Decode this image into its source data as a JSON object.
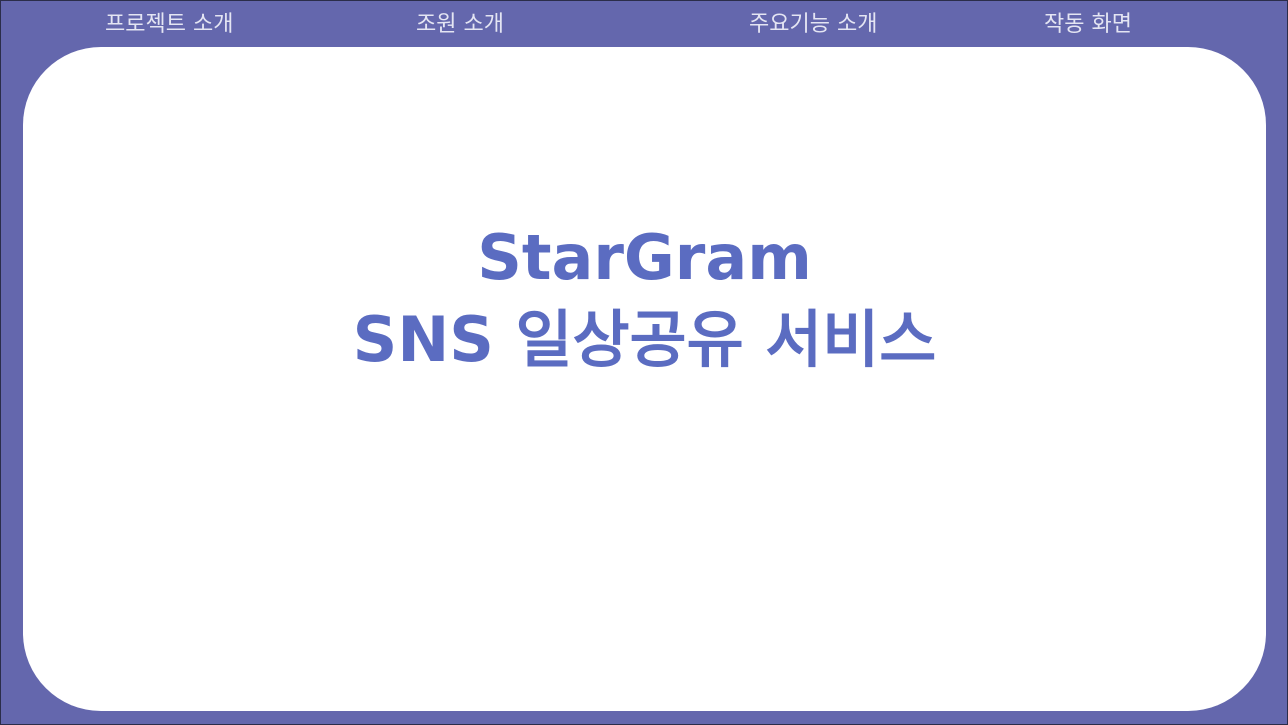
{
  "nav": {
    "items": [
      {
        "label": "프로젝트 소개"
      },
      {
        "label": "조원 소개"
      },
      {
        "label": "주요기능 소개"
      },
      {
        "label": "작동 화면"
      }
    ]
  },
  "hero": {
    "title_line1": "StarGram",
    "title_line2": "SNS 일상공유 서비스"
  },
  "colors": {
    "frame": "#6467ad",
    "card": "#ffffff",
    "title": "#5b6cc1",
    "nav_text": "#e4e5f3"
  }
}
